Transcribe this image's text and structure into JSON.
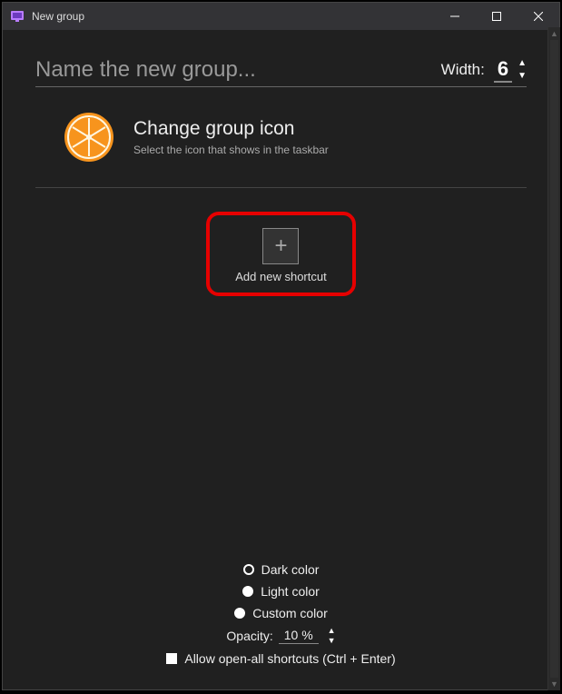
{
  "titlebar": {
    "title": "New group"
  },
  "name": {
    "placeholder": "Name the new group..."
  },
  "width": {
    "label": "Width:",
    "value": "6"
  },
  "changeIcon": {
    "title": "Change group icon",
    "subtitle": "Select the icon that shows in the taskbar"
  },
  "addShortcut": {
    "label": "Add new shortcut"
  },
  "colorOptions": {
    "dark": "Dark color",
    "light": "Light color",
    "custom": "Custom color"
  },
  "opacity": {
    "label": "Opacity:",
    "value": "10 %"
  },
  "allowOpenAll": {
    "label": "Allow open-all shortcuts (Ctrl + Enter)"
  }
}
